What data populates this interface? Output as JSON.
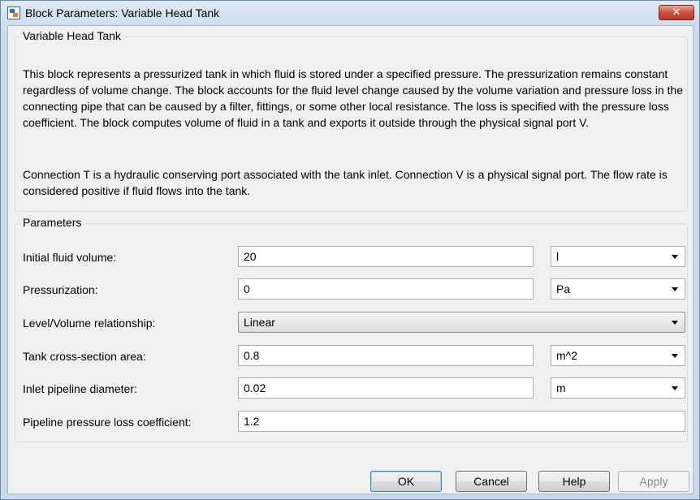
{
  "window": {
    "title": "Block Parameters: Variable Head Tank",
    "close_glyph": "✕"
  },
  "block_group": {
    "label": "Variable Head Tank",
    "description_1": "This block represents a pressurized tank in which fluid is stored under a specified pressure. The pressurization remains constant regardless of volume change. The block accounts for the fluid level change caused by the volume variation and pressure loss in the connecting pipe that can be caused by a filter, fittings, or some other local resistance. The loss is specified with the pressure loss coefficient. The block computes volume of fluid in a tank and exports it outside through the physical signal port V.",
    "description_2": "Connection T is a hydraulic conserving port associated with the tank inlet. Connection V is a physical signal port. The flow rate is considered positive if fluid flows into the tank."
  },
  "params_group": {
    "label": "Parameters",
    "rows": [
      {
        "label": "Initial fluid volume:",
        "value": "20",
        "unit": "l"
      },
      {
        "label": "Pressurization:",
        "value": "0",
        "unit": "Pa"
      },
      {
        "label": "Level/Volume relationship:",
        "value": "Linear"
      },
      {
        "label": "Tank cross-section area:",
        "value": "0.8",
        "unit": "m^2"
      },
      {
        "label": "Inlet pipeline diameter:",
        "value": "0.02",
        "unit": "m"
      },
      {
        "label": "Pipeline pressure loss coefficient:",
        "value": "1.2"
      }
    ]
  },
  "buttons": {
    "ok": "OK",
    "cancel": "Cancel",
    "help": "Help",
    "apply": "Apply"
  },
  "icons": {
    "app": "simulink-block-icon",
    "close": "close-icon",
    "dropdown": "chevron-down-icon"
  }
}
